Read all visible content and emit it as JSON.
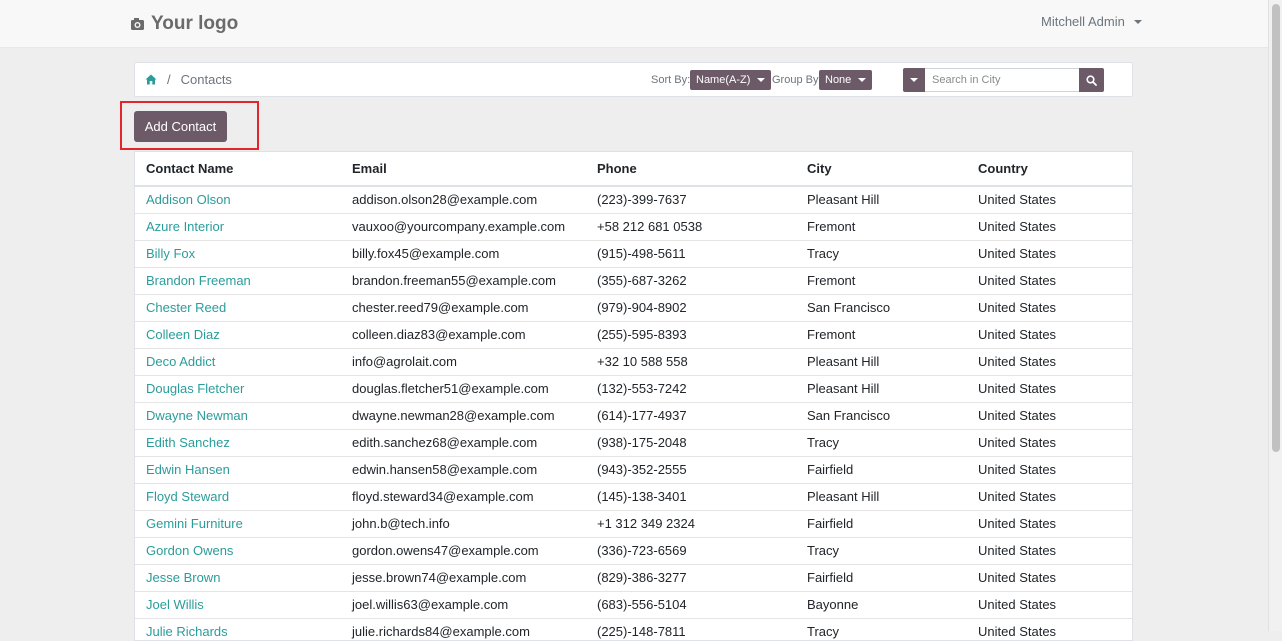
{
  "header": {
    "logo_text": "Your logo",
    "user_name": "Mitchell Admin"
  },
  "breadcrumb": {
    "current": "Contacts",
    "separator": "/"
  },
  "controls": {
    "sort_label": "Sort By:",
    "sort_value": "Name(A-Z)",
    "group_label": "Group By:",
    "group_value": "None",
    "search_placeholder": "Search in City"
  },
  "add_contact_label": "Add Contact",
  "colors": {
    "accent": "#6d5a68",
    "link": "#2a9d9a",
    "highlight": "#e3262b"
  },
  "table": {
    "columns": [
      "Contact Name",
      "Email",
      "Phone",
      "City",
      "Country"
    ],
    "rows": [
      [
        "Addison Olson",
        "addison.olson28@example.com",
        "(223)-399-7637",
        "Pleasant Hill",
        "United States"
      ],
      [
        "Azure Interior",
        "vauxoo@yourcompany.example.com",
        "+58 212 681 0538",
        "Fremont",
        "United States"
      ],
      [
        "Billy Fox",
        "billy.fox45@example.com",
        "(915)-498-5611",
        "Tracy",
        "United States"
      ],
      [
        "Brandon Freeman",
        "brandon.freeman55@example.com",
        "(355)-687-3262",
        "Fremont",
        "United States"
      ],
      [
        "Chester Reed",
        "chester.reed79@example.com",
        "(979)-904-8902",
        "San Francisco",
        "United States"
      ],
      [
        "Colleen Diaz",
        "colleen.diaz83@example.com",
        "(255)-595-8393",
        "Fremont",
        "United States"
      ],
      [
        "Deco Addict",
        "info@agrolait.com",
        "+32 10 588 558",
        "Pleasant Hill",
        "United States"
      ],
      [
        "Douglas Fletcher",
        "douglas.fletcher51@example.com",
        "(132)-553-7242",
        "Pleasant Hill",
        "United States"
      ],
      [
        "Dwayne Newman",
        "dwayne.newman28@example.com",
        "(614)-177-4937",
        "San Francisco",
        "United States"
      ],
      [
        "Edith Sanchez",
        "edith.sanchez68@example.com",
        "(938)-175-2048",
        "Tracy",
        "United States"
      ],
      [
        "Edwin Hansen",
        "edwin.hansen58@example.com",
        "(943)-352-2555",
        "Fairfield",
        "United States"
      ],
      [
        "Floyd Steward",
        "floyd.steward34@example.com",
        "(145)-138-3401",
        "Pleasant Hill",
        "United States"
      ],
      [
        "Gemini Furniture",
        "john.b@tech.info",
        "+1 312 349 2324",
        "Fairfield",
        "United States"
      ],
      [
        "Gordon Owens",
        "gordon.owens47@example.com",
        "(336)-723-6569",
        "Tracy",
        "United States"
      ],
      [
        "Jesse Brown",
        "jesse.brown74@example.com",
        "(829)-386-3277",
        "Fairfield",
        "United States"
      ],
      [
        "Joel Willis",
        "joel.willis63@example.com",
        "(683)-556-5104",
        "Bayonne",
        "United States"
      ],
      [
        "Julie Richards",
        "julie.richards84@example.com",
        "(225)-148-7811",
        "Tracy",
        "United States"
      ]
    ]
  }
}
